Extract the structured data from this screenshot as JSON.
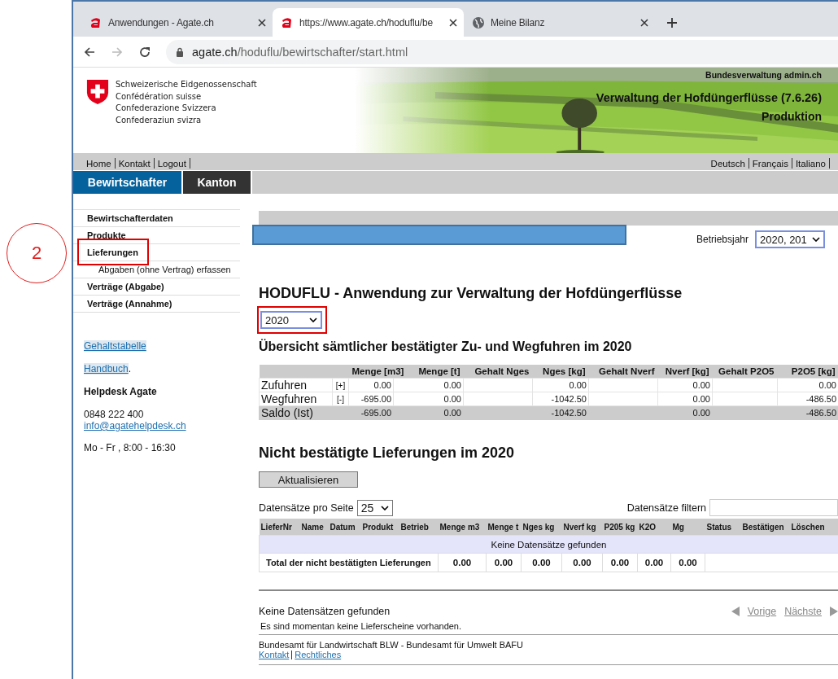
{
  "annotation": {
    "label": "2"
  },
  "browser": {
    "tabs": [
      {
        "title": "Anwendungen - Agate.ch",
        "kind": "app",
        "selected": false
      },
      {
        "title": "https://www.agate.ch/hoduflu/be",
        "kind": "app",
        "selected": true
      },
      {
        "title": "Meine Bilanz",
        "kind": "site",
        "selected": false
      }
    ],
    "address": {
      "domain": "agate.ch",
      "path": "/hoduflu/bewirtschafter/start.html"
    }
  },
  "header": {
    "confederation": [
      "Schweizerische Eidgenossenschaft",
      "Confédération suisse",
      "Confederazione Svizzera",
      "Confederaziun svizra"
    ],
    "portal": "Bundesverwaltung admin.ch",
    "app_title": "Verwaltung der Hofdüngerflüsse (7.6.26)",
    "mode": "Produktion"
  },
  "top_links": [
    "Home",
    "Kontakt",
    "Logout"
  ],
  "languages": [
    "Deutsch",
    "Français",
    "Italiano"
  ],
  "main_tabs": [
    {
      "label": "Bewirtschafter",
      "selected": true
    },
    {
      "label": "Kanton",
      "selected": false
    }
  ],
  "sidebar": {
    "items": [
      {
        "label": "Bewirtschafterdaten",
        "kind": "section",
        "highlighted": false
      },
      {
        "label": "Produkte",
        "kind": "section",
        "highlighted": false
      },
      {
        "label": "Lieferungen",
        "kind": "section",
        "highlighted": true
      },
      {
        "label": "Abgaben (ohne Vertrag) erfassen",
        "kind": "sub",
        "highlighted": false
      },
      {
        "label": "Verträge (Abgabe)",
        "kind": "section",
        "highlighted": false
      },
      {
        "label": "Verträge (Annahme)",
        "kind": "section",
        "highlighted": false
      }
    ],
    "links": [
      {
        "label": "Gehaltstabelle"
      },
      {
        "label": "Handbuch",
        "suffix": "."
      }
    ],
    "helpdesk": {
      "title": "Helpdesk Agate",
      "phone": "0848 222 400",
      "email": "info@agatehelpdesk.ch",
      "hours": "Mo - Fr , 8:00 - 16:30"
    }
  },
  "year_filter": {
    "label": "Betriebsjahr",
    "value": "2020, 201"
  },
  "title": "HODUFLU - Anwendung zur Verwaltung der Hofdüngerflüsse",
  "year_select": {
    "value": "2020",
    "highlighted": true
  },
  "overview": {
    "title": "Übersicht sämtlicher bestätigter Zu- und Wegfuhren im 2020",
    "columns": [
      "Menge [m3]",
      "Menge [t]",
      "Gehalt Nges",
      "Nges [kg]",
      "Gehalt Nverf",
      "Nverf [kg]",
      "Gehalt P2O5",
      "P2O5 [kg]"
    ],
    "rows": [
      {
        "label": "Zufuhren",
        "sign": "[+]",
        "kind": "entry",
        "cells": [
          "0.00",
          "0.00",
          null,
          "0.00",
          null,
          "0.00",
          null,
          "0.00"
        ]
      },
      {
        "label": "Wegfuhren",
        "sign": "[-]",
        "kind": "entry",
        "cells": [
          "-695.00",
          "0.00",
          null,
          "-1042.50",
          null,
          "0.00",
          null,
          "-486.50"
        ]
      },
      {
        "label": "Saldo (Ist)",
        "sign": null,
        "kind": "total",
        "cells": [
          "-695.00",
          "0.00",
          null,
          "-1042.50",
          null,
          "0.00",
          null,
          "-486.50"
        ]
      }
    ]
  },
  "pending": {
    "title": "Nicht bestätigte Lieferungen im 2020",
    "refresh_button": "Aktualisieren",
    "page_size_label": "Datensätze pro Seite",
    "page_size": "25",
    "filter_label": "Datensätze filtern",
    "columns": [
      "LieferNr",
      "Name",
      "Datum",
      "Produkt",
      "Betrieb",
      "Menge m3",
      "Menge t",
      "Nges kg",
      "Nverf kg",
      "P205 kg",
      "K2O",
      "Mg",
      "Status",
      "Bestätigen",
      "Löschen"
    ],
    "empty_text": "Keine Datensätze gefunden",
    "total": {
      "label": "Total der nicht bestätigten Lieferungen",
      "values": [
        "0.00",
        "0.00",
        "0.00",
        "0.00",
        "0.00",
        "0.00",
        "0.00"
      ]
    }
  },
  "pager": {
    "status": "Keine Datensätzen gefunden",
    "prev": "Vorige",
    "next": "Nächste",
    "message": "Es sind momentan keine Lieferscheine vorhanden."
  },
  "footer": {
    "agencies": "Bundesamt für Landwirtschaft BLW - Bundesamt für Umwelt BAFU",
    "links": [
      "Kontakt",
      "Rechtliches"
    ]
  }
}
